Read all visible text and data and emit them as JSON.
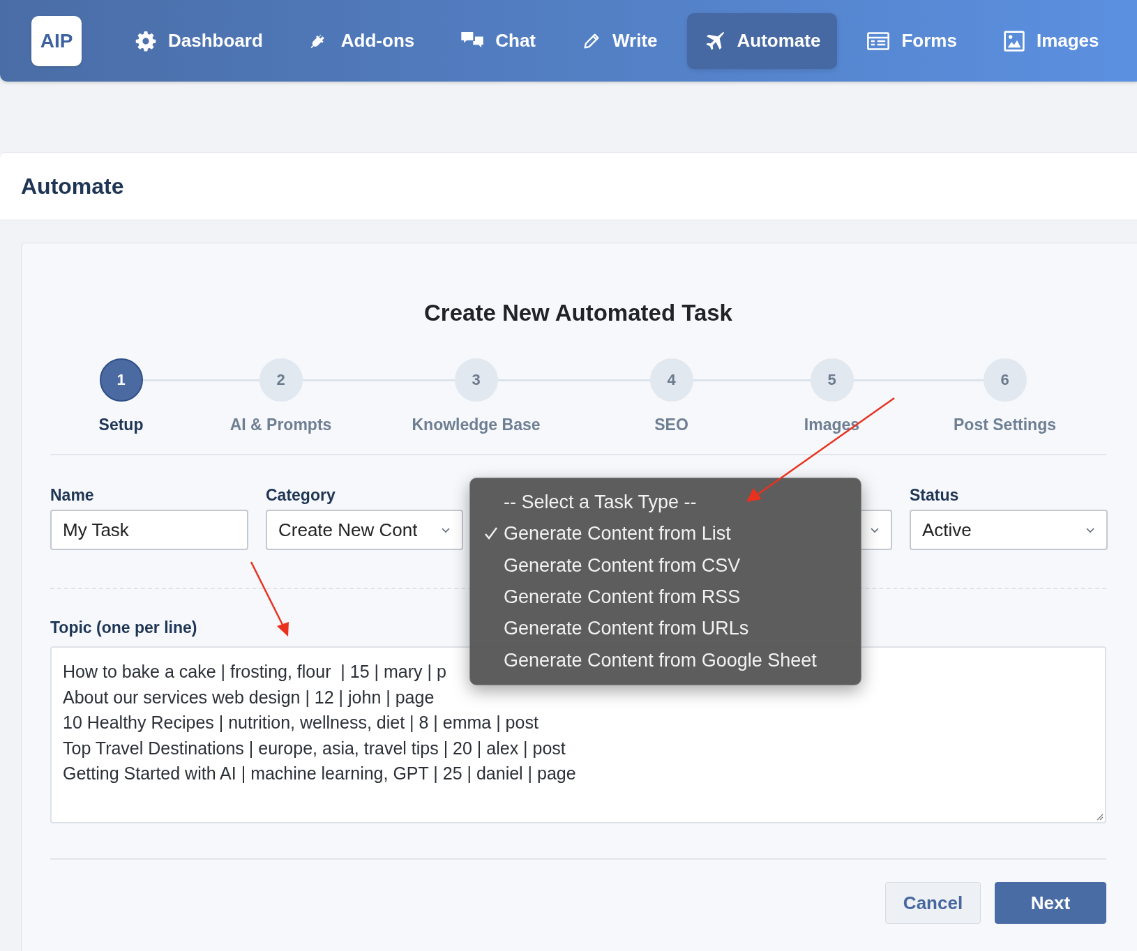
{
  "nav": {
    "logo": "AIP",
    "items": [
      {
        "label": "Dashboard",
        "selected": false
      },
      {
        "label": "Add-ons",
        "selected": false
      },
      {
        "label": "Chat",
        "selected": false
      },
      {
        "label": "Write",
        "selected": false
      },
      {
        "label": "Automate",
        "selected": true
      },
      {
        "label": "Forms",
        "selected": false
      },
      {
        "label": "Images",
        "selected": false
      }
    ]
  },
  "page_title": "Automate",
  "card": {
    "title": "Create New Automated Task",
    "steps": [
      {
        "number": "1",
        "label": "Setup",
        "selected": true
      },
      {
        "number": "2",
        "label": "AI & Prompts",
        "selected": false
      },
      {
        "number": "3",
        "label": "Knowledge Base",
        "selected": false
      },
      {
        "number": "4",
        "label": "SEO",
        "selected": false
      },
      {
        "number": "5",
        "label": "Images",
        "selected": false
      },
      {
        "number": "6",
        "label": "Post Settings",
        "selected": false
      }
    ],
    "fields": [
      {
        "kind": "text",
        "label": "Name",
        "value": "My Task"
      },
      {
        "kind": "select",
        "label": "Category",
        "value": "Create New Cont"
      },
      {
        "kind": "select"
      },
      {
        "kind": "select",
        "label": "Status",
        "value": "Active"
      }
    ],
    "dropdown": {
      "options": [
        {
          "label": "-- Select a Task Type --",
          "selected": false
        },
        {
          "label": "Generate Content from List",
          "selected": true
        },
        {
          "label": "Generate Content from CSV",
          "selected": false
        },
        {
          "label": "Generate Content from RSS",
          "selected": false
        },
        {
          "label": "Generate Content from URLs",
          "selected": false
        },
        {
          "label": "Generate Content from Google Sheet",
          "selected": false
        }
      ]
    },
    "topic": {
      "label": "Topic (one per line)",
      "lines": [
        "How to bake a cake | frosting, flour  | 15 | mary | p",
        "About our services web design | 12 | john | page",
        "10 Healthy Recipes | nutrition, wellness, diet | 8 | emma | post",
        "Top Travel Destinations | europe, asia, travel tips | 20 | alex | post",
        "Getting Started with AI | machine learning, GPT | 25 | daniel | page"
      ]
    },
    "buttons": [
      {
        "label": "Cancel",
        "kind": "secondary"
      },
      {
        "label": "Next",
        "kind": "primary"
      }
    ]
  }
}
